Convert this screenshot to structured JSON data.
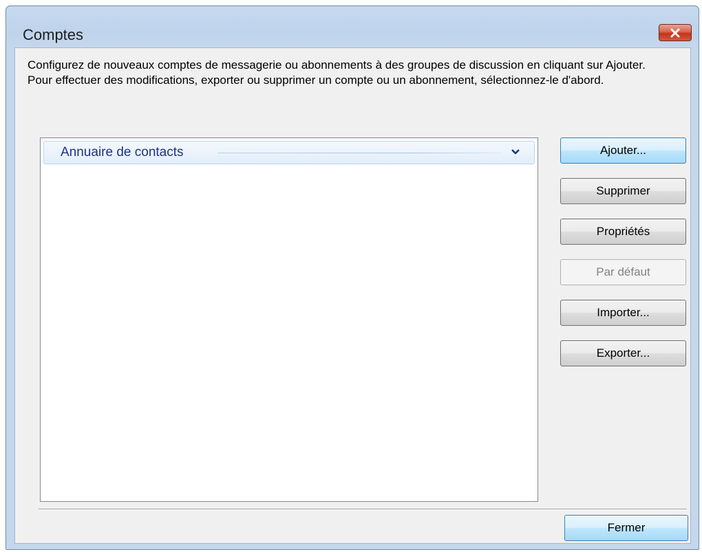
{
  "window": {
    "title": "Comptes",
    "close_icon": "close-icon"
  },
  "description": {
    "line1": "Configurez de nouveaux comptes de messagerie ou abonnements à des groupes de discussion en cliquant sur Ajouter.",
    "line2": "Pour effectuer des modifications, exporter ou supprimer un compte ou un abonnement, sélectionnez-le d'abord."
  },
  "accounts_list": {
    "group_label": "Annuaire de contacts",
    "group_icon": "chevron-down-icon"
  },
  "buttons": {
    "add": "Ajouter...",
    "remove": "Supprimer",
    "properties": "Propriétés",
    "set_default": "Par défaut",
    "import": "Importer...",
    "export": "Exporter...",
    "close": "Fermer"
  },
  "colors": {
    "titlebar": "#c5d7ec",
    "close_button": "#c4331b",
    "group_header_text": "#1e3287",
    "default_button": "#bee6fd"
  }
}
